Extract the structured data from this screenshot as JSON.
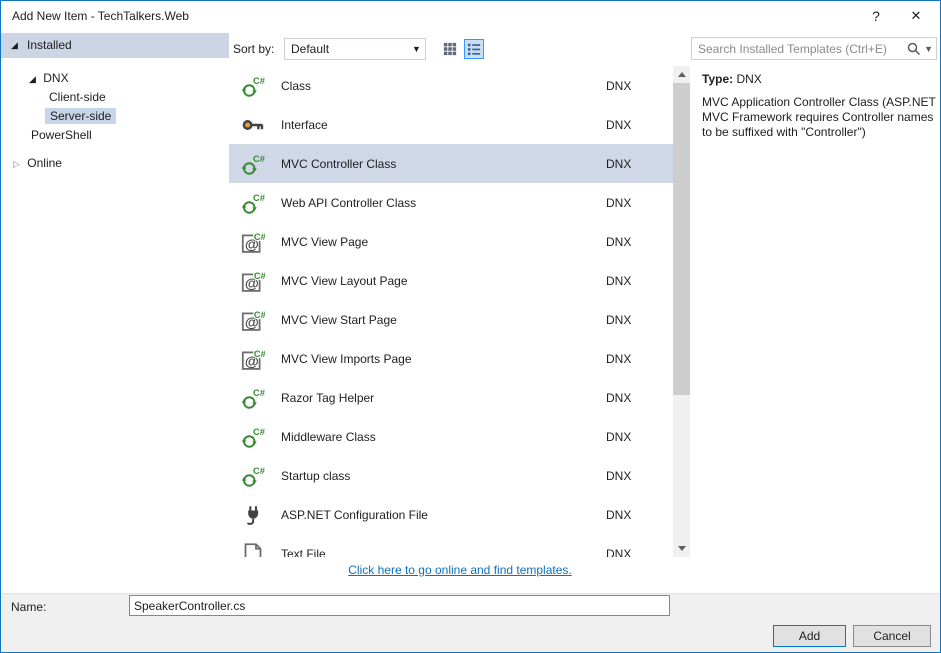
{
  "window": {
    "title": "Add New Item - TechTalkers.Web",
    "help": "?",
    "close": "✕"
  },
  "sidebar": {
    "items": [
      {
        "label": "Installed",
        "state": "expanded"
      },
      {
        "label": "DNX",
        "state": "expanded"
      },
      {
        "label": "Client-side"
      },
      {
        "label": "Server-side",
        "selected": true
      },
      {
        "label": "PowerShell"
      },
      {
        "label": "Online",
        "state": "collapsed"
      }
    ]
  },
  "toolbar": {
    "sort_label": "Sort by:",
    "sort_value": "Default",
    "view_modes": [
      "small-icons",
      "list"
    ],
    "active_view": "list"
  },
  "search": {
    "placeholder": "Search Installed Templates (Ctrl+E)",
    "icons": [
      "search-icon",
      "chevron-down-icon"
    ]
  },
  "templates": {
    "selected_index": 2,
    "items": [
      {
        "name": "Class",
        "platform": "DNX",
        "icon": "csharp-class-icon"
      },
      {
        "name": "Interface",
        "platform": "DNX",
        "icon": "interface-key-icon"
      },
      {
        "name": "MVC Controller Class",
        "platform": "DNX",
        "icon": "csharp-class-icon"
      },
      {
        "name": "Web API Controller Class",
        "platform": "DNX",
        "icon": "csharp-class-icon"
      },
      {
        "name": "MVC View Page",
        "platform": "DNX",
        "icon": "mvc-view-icon"
      },
      {
        "name": "MVC View Layout Page",
        "platform": "DNX",
        "icon": "mvc-view-icon"
      },
      {
        "name": "MVC View Start Page",
        "platform": "DNX",
        "icon": "mvc-view-icon"
      },
      {
        "name": "MVC View Imports Page",
        "platform": "DNX",
        "icon": "mvc-view-icon"
      },
      {
        "name": "Razor Tag Helper",
        "platform": "DNX",
        "icon": "csharp-class-icon"
      },
      {
        "name": "Middleware Class",
        "platform": "DNX",
        "icon": "csharp-class-icon"
      },
      {
        "name": "Startup class",
        "platform": "DNX",
        "icon": "csharp-class-icon"
      },
      {
        "name": "ASP.NET Configuration File",
        "platform": "DNX",
        "icon": "config-file-icon"
      },
      {
        "name": "Text File",
        "platform": "DNX",
        "icon": "text-file-icon"
      }
    ]
  },
  "info": {
    "type_label": "Type:",
    "type_value": "DNX",
    "description": "MVC Application Controller Class (ASP.NET MVC Framework requires Controller names to be suffixed with \"Controller\")"
  },
  "footer": {
    "online_link": "Click here to go online and find templates.",
    "name_label": "Name:",
    "name_value": "SpeakerController.cs",
    "add": "Add",
    "cancel": "Cancel"
  },
  "colors": {
    "window_border": "#0f74c4",
    "selection": "#d0d8e7",
    "category_header": "#ccd5e3",
    "link": "#0e70c0",
    "accent_green": "#388a34"
  }
}
